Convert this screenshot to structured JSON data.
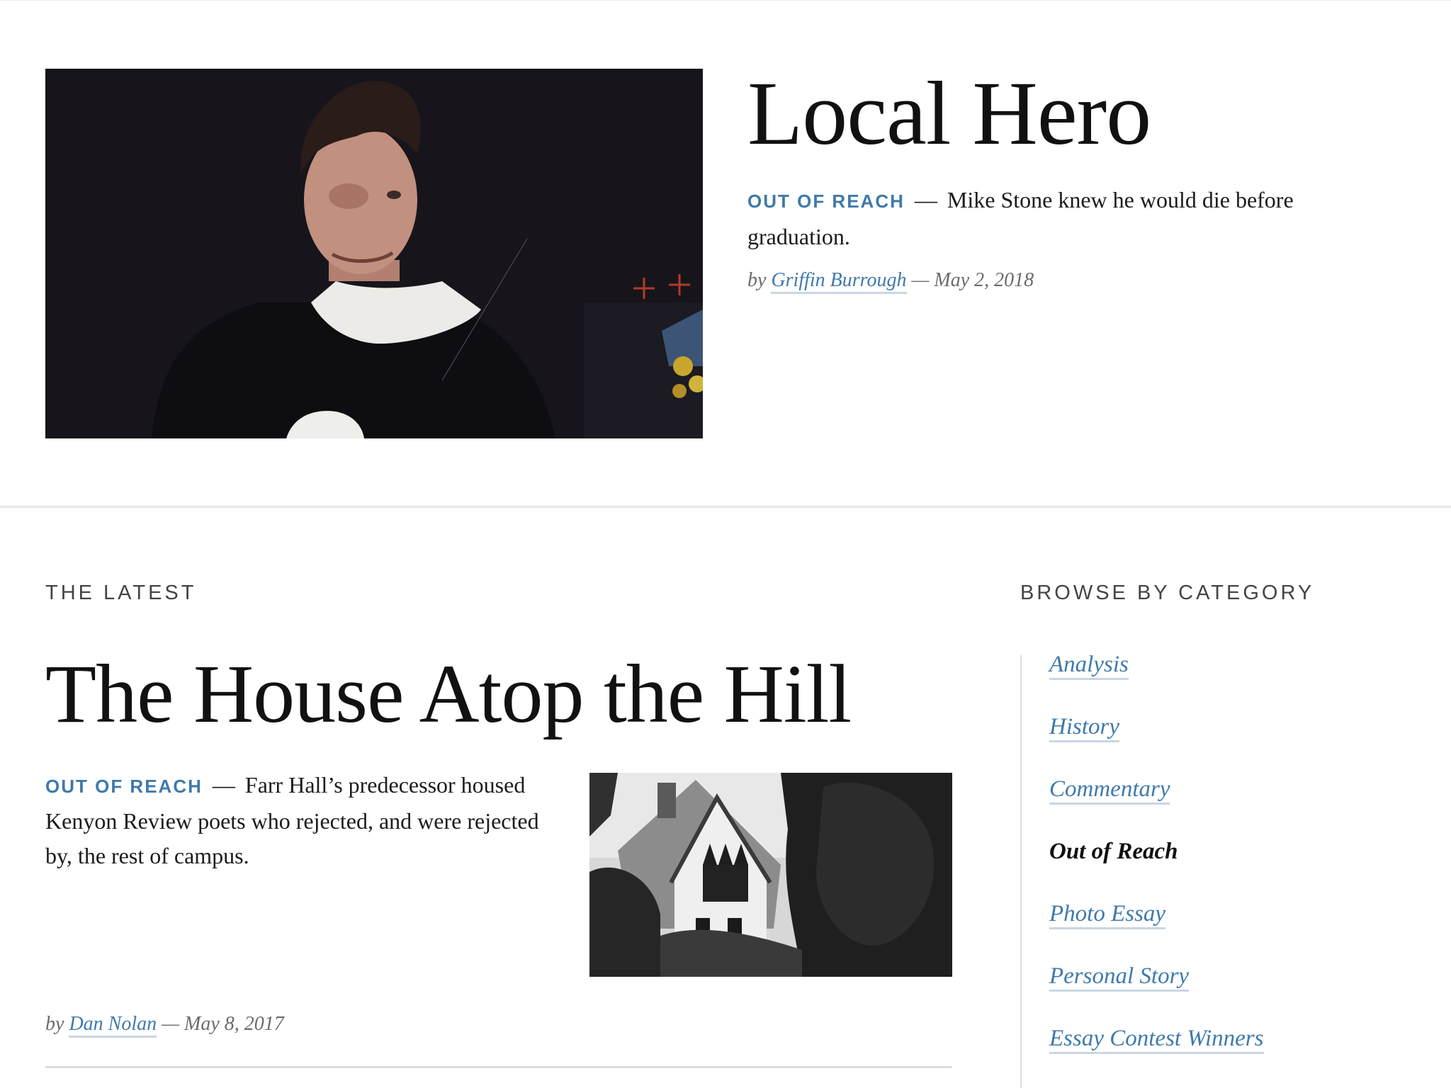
{
  "feature": {
    "title": "Local Hero",
    "kicker": "OUT OF REACH",
    "dash": "—",
    "dek": "Mike Stone knew he would die before graduation.",
    "by_label": "by",
    "author": "Griffin Burrough",
    "date": "— May 2, 2018"
  },
  "latest": {
    "section_label": "THE LATEST",
    "title": "The House Atop the Hill",
    "kicker": "OUT OF REACH",
    "dash": "—",
    "dek": "Farr Hall’s predecessor housed Kenyon Review poets who rejected, and were rejected by, the rest of campus.",
    "by_label": "by",
    "author": "Dan Nolan",
    "date": "— May 8, 2017"
  },
  "sidebar": {
    "heading": "BROWSE BY CATEGORY",
    "categories": [
      {
        "label": "Analysis"
      },
      {
        "label": "History"
      },
      {
        "label": "Commentary"
      },
      {
        "label": "Out of Reach"
      },
      {
        "label": "Photo Essay"
      },
      {
        "label": "Personal Story"
      },
      {
        "label": "Essay Contest Winners"
      }
    ],
    "active": "Out of Reach"
  },
  "colors": {
    "accent": "#3f7aab",
    "text": "#111111",
    "muted": "#6b6b6b"
  }
}
